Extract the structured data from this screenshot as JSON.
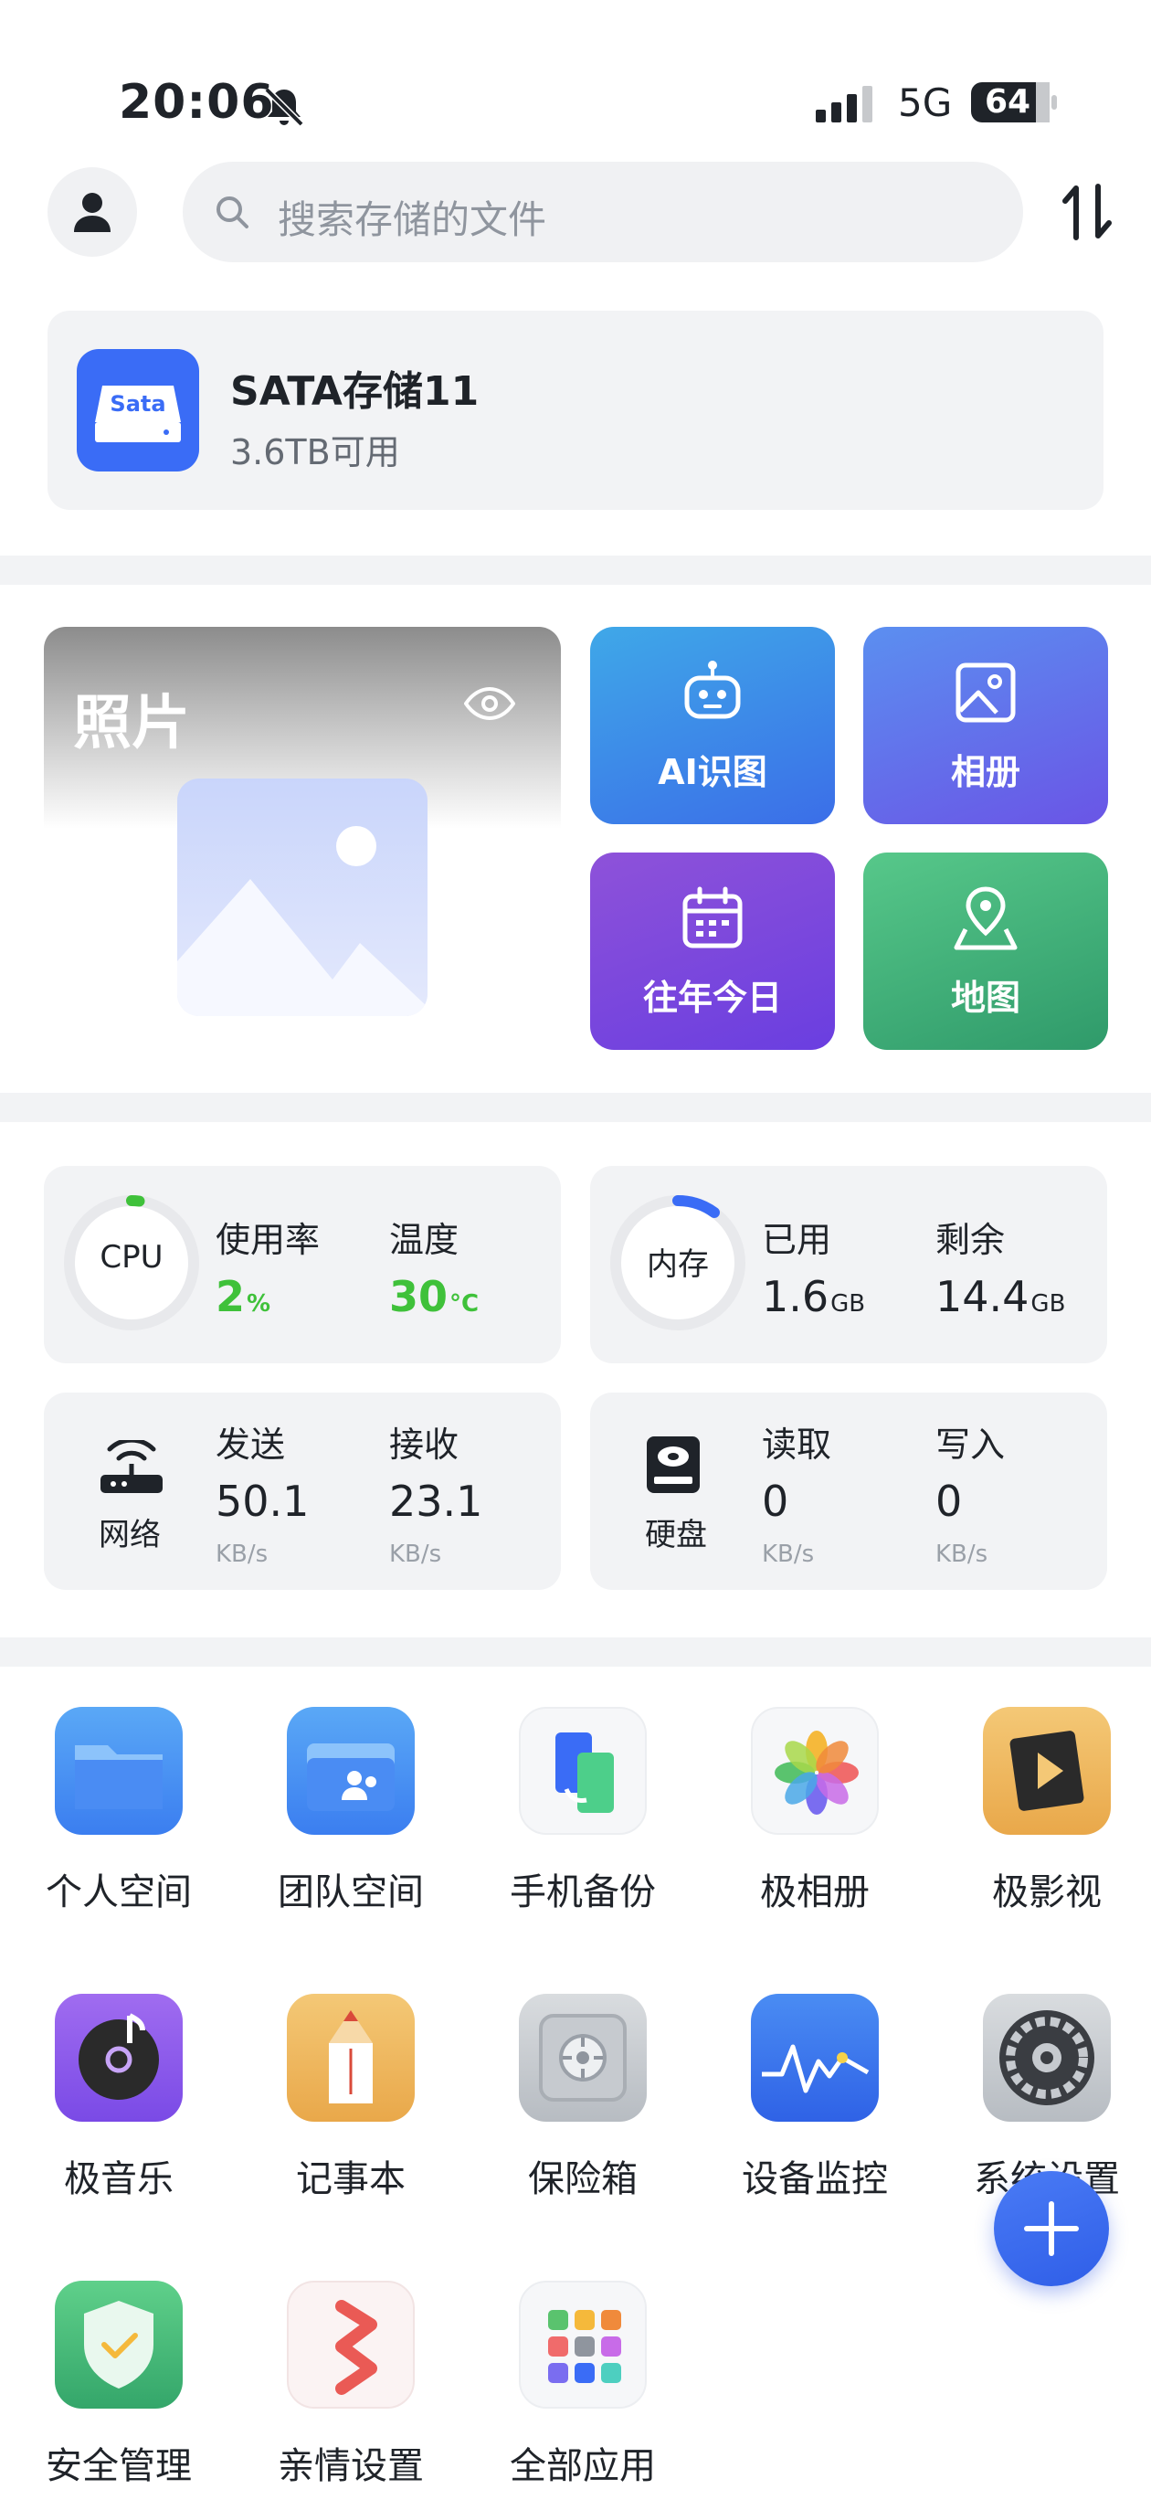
{
  "status_bar": {
    "time": "20:06",
    "network": "5G",
    "battery": "64",
    "icons": [
      "bell-muted-icon",
      "signal-icon",
      "battery-icon"
    ]
  },
  "header": {
    "search_placeholder": "搜索存储的文件",
    "icons": [
      "user-icon",
      "search-icon",
      "sort-icon"
    ]
  },
  "storage": {
    "icon_text": "Sata",
    "name": "SATA存储11",
    "free": "3.6TB可用"
  },
  "photos": {
    "title": "照片",
    "tiles": [
      {
        "label": "AI识图",
        "icon": "robot-icon"
      },
      {
        "label": "相册",
        "icon": "image-icon"
      },
      {
        "label": "往年今日",
        "icon": "calendar-icon"
      },
      {
        "label": "地图",
        "icon": "map-pin-icon"
      }
    ]
  },
  "stats": {
    "cpu": {
      "ring_label": "CPU",
      "usage_label": "使用率",
      "usage_value": "2",
      "usage_unit": "%",
      "usage_fraction": 0.02,
      "temp_label": "温度",
      "temp_value": "30",
      "temp_unit": "°C"
    },
    "memory": {
      "ring_label": "内存",
      "used_label": "已用",
      "used_value": "1.6",
      "used_unit": "GB",
      "free_label": "剩余",
      "free_value": "14.4",
      "free_unit": "GB",
      "used_fraction": 0.1
    },
    "network": {
      "label": "网络",
      "send_label": "发送",
      "send_value": "50.1",
      "send_unit": "KB/s",
      "recv_label": "接收",
      "recv_value": "23.1",
      "recv_unit": "KB/s"
    },
    "disk": {
      "label": "硬盘",
      "read_label": "读取",
      "read_value": "0",
      "read_unit": "KB/s",
      "write_label": "写入",
      "write_value": "0",
      "write_unit": "KB/s"
    }
  },
  "apps": [
    {
      "label": "个人空间",
      "icon": "folder-icon"
    },
    {
      "label": "团队空间",
      "icon": "team-folder-icon"
    },
    {
      "label": "手机备份",
      "icon": "phone-backup-icon"
    },
    {
      "label": "极相册",
      "icon": "photos-flower-icon"
    },
    {
      "label": "极影视",
      "icon": "film-icon"
    },
    {
      "label": "极音乐",
      "icon": "music-icon"
    },
    {
      "label": "记事本",
      "icon": "notes-icon"
    },
    {
      "label": "保险箱",
      "icon": "safe-icon"
    },
    {
      "label": "设备监控",
      "icon": "monitor-icon"
    },
    {
      "label": "系统设置",
      "icon": "settings-gear-icon"
    },
    {
      "label": "安全管理",
      "icon": "shield-icon"
    },
    {
      "label": "亲情设置",
      "icon": "family-icon"
    },
    {
      "label": "全部应用",
      "icon": "all-apps-icon"
    }
  ],
  "fab": {
    "icon": "plus-icon"
  }
}
